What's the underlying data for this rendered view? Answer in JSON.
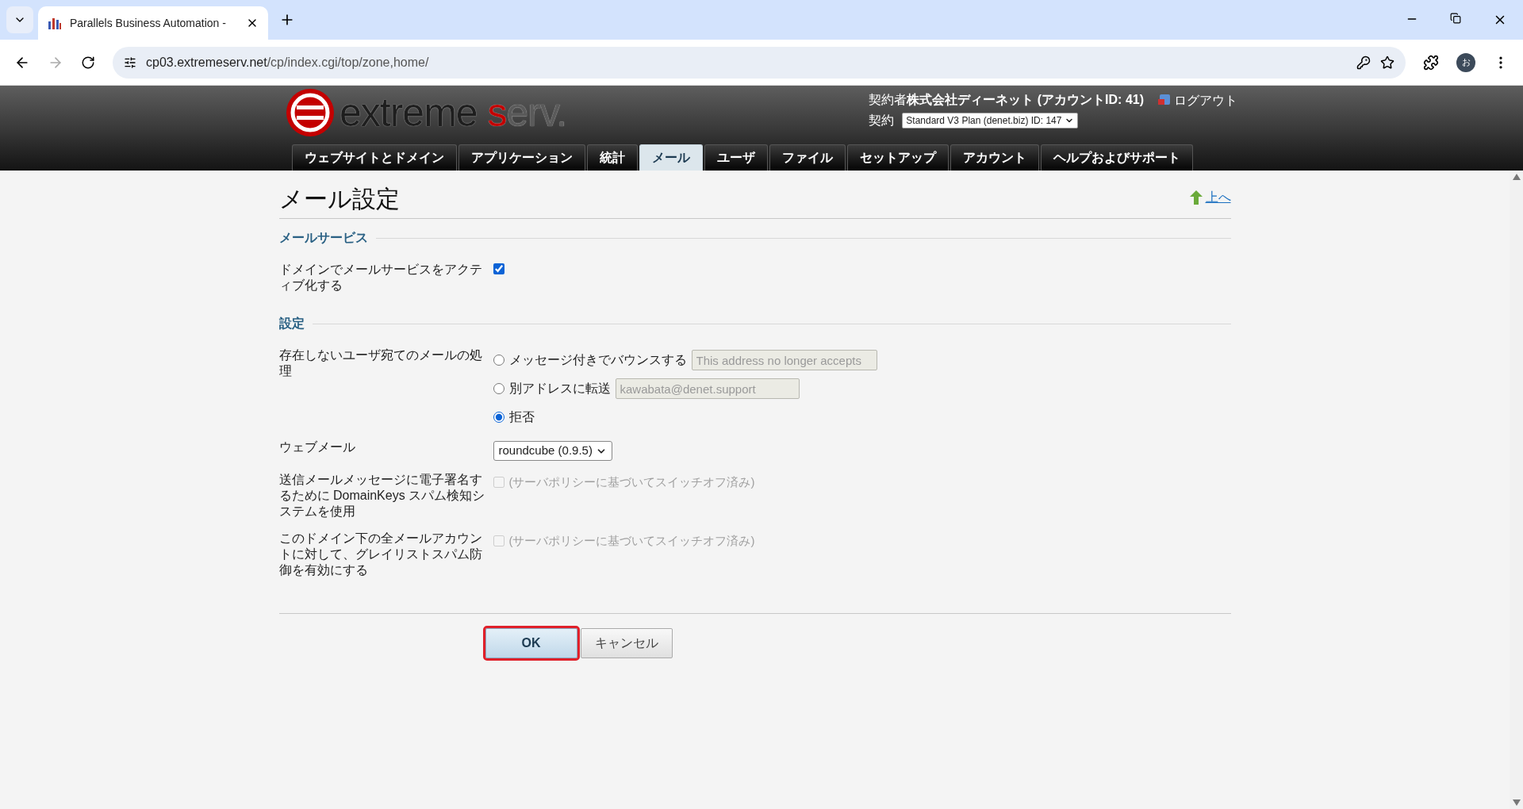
{
  "browser": {
    "tab_title": "Parallels Business Automation -",
    "url_host": "cp03.extremeserv.net",
    "url_path": "/cp/index.cgi/top/zone,home/",
    "profile": "お"
  },
  "header": {
    "logo": [
      {
        "text": "extreme ",
        "color": "#1e1e1e"
      },
      {
        "text": "s",
        "color": "#c40000"
      },
      {
        "text": "erv.",
        "color": "#5a5a5a"
      }
    ],
    "contract": "契約者**株式会社ディーネット (アカウントID: 41)**",
    "plan_label": "契約",
    "plan_select": "Standard V3 Plan (denet.biz) ID: 147",
    "logout": "ログアウト"
  },
  "nav": [
    {
      "label": "ウェブサイトとドメイン",
      "selected": false
    },
    {
      "label": "アプリケーション",
      "selected": false
    },
    {
      "label": "統計",
      "selected": false
    },
    {
      "label": "メール",
      "selected": true
    },
    {
      "label": "ユーザ",
      "selected": false
    },
    {
      "label": "ファイル",
      "selected": false
    },
    {
      "label": "セットアップ",
      "selected": false
    },
    {
      "label": "アカウント",
      "selected": false
    },
    {
      "label": "ヘルプおよびサポート",
      "selected": false
    }
  ],
  "page": {
    "title": "メール設定",
    "up_link": "上へ"
  },
  "sections": [
    {
      "title": "メールサービス",
      "rows": [
        {
          "kind": "checkbox",
          "label": "ドメインでメールサービスをアクティブ化する",
          "checked": true,
          "disabled": false
        }
      ]
    },
    {
      "title": "設定",
      "rows": [
        {
          "kind": "radio",
          "label": "存在しないユーザ宛てのメールの処理",
          "options": [
            {
              "label": "メッセージ付きでバウンスする",
              "selected": false,
              "field": {
                "value": "This address no longer accepts",
                "disabled": true
              }
            },
            {
              "label": "別アドレスに転送",
              "selected": false,
              "field": {
                "value": "kawabata@denet.support",
                "disabled": true
              }
            },
            {
              "label": "拒否",
              "selected": true
            }
          ]
        },
        {
          "kind": "select",
          "label": "ウェブメール",
          "value": "roundcube (0.9.5)"
        },
        {
          "kind": "checkbox",
          "label": "送信メールメッセージに電子署名するために DomainKeys スパム検知システムを使用",
          "checked": false,
          "disabled": true,
          "text": "(サーバポリシーに基づいてスイッチオフ済み)"
        },
        {
          "kind": "checkbox",
          "label": "このドメイン下の全メールアカウントに対して、グレイリストスパム防御を有効にする",
          "checked": false,
          "disabled": true,
          "text": "(サーバポリシーに基づいてスイッチオフ済み)"
        }
      ]
    }
  ],
  "buttons": [
    {
      "label": "OK",
      "primary": true,
      "highlighted": true
    },
    {
      "label": "キャンセル",
      "primary": false,
      "highlighted": false
    }
  ]
}
